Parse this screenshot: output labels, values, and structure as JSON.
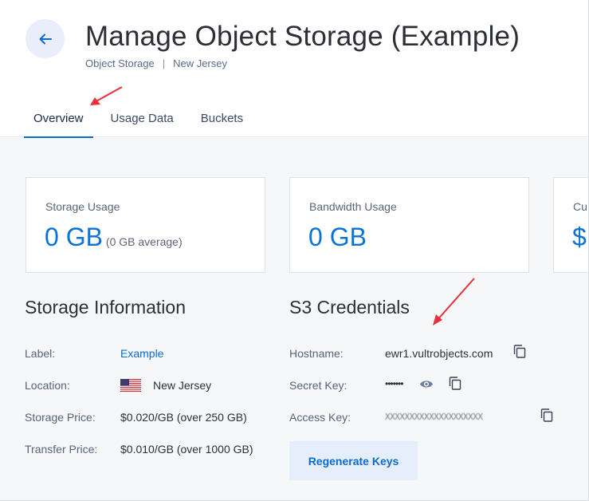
{
  "header": {
    "title": "Manage Object Storage (Example)",
    "breadcrumb": [
      "Object Storage",
      "New Jersey"
    ],
    "breadcrumb_separator": "|"
  },
  "tabs": [
    {
      "label": "Overview",
      "active": true
    },
    {
      "label": "Usage Data",
      "active": false
    },
    {
      "label": "Buckets",
      "active": false
    }
  ],
  "cards": {
    "storage": {
      "label": "Storage Usage",
      "value": "0 GB",
      "sub": "(0 GB average)"
    },
    "bandwidth": {
      "label": "Bandwidth Usage",
      "value": "0 GB"
    },
    "current": {
      "label": "Cu",
      "value": "$"
    }
  },
  "storage_info": {
    "title": "Storage Information",
    "rows": [
      {
        "label": "Label:",
        "value": "Example"
      },
      {
        "label": "Location:",
        "value": "New Jersey"
      },
      {
        "label": "Storage Price:",
        "value": "$0.020/GB (over 250 GB)"
      },
      {
        "label": "Transfer Price:",
        "value": "$0.010/GB (over 1000 GB)"
      }
    ]
  },
  "s3": {
    "title": "S3 Credentials",
    "rows": [
      {
        "label": "Hostname:",
        "value": "ewr1.vultrobjects.com"
      },
      {
        "label": "Secret Key:",
        "value": "•••••••"
      },
      {
        "label": "Access Key:",
        "value": "XXXXXXXXXXXXXXXXXXXX"
      }
    ],
    "regenerate_label": "Regenerate Keys"
  },
  "icons": {
    "back": "arrow-left-icon",
    "copy": "copy-icon",
    "eye": "eye-icon",
    "flag": "us-flag-icon"
  },
  "colors": {
    "accent": "#0a6ccf",
    "value_blue": "#0a73d6",
    "annotation_red": "#e8313b"
  }
}
